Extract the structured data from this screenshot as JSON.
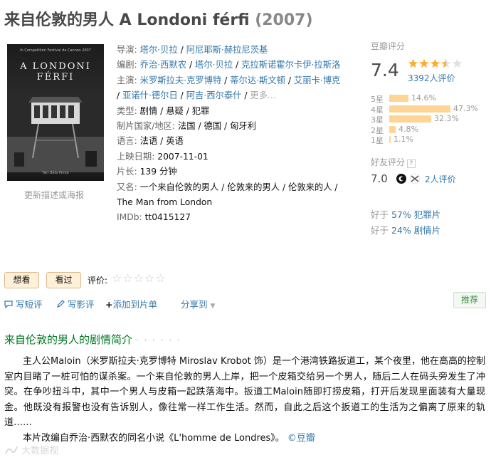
{
  "title": {
    "main": "来自伦敦的男人 A Londoni férfi",
    "year": "(2007)"
  },
  "poster": {
    "title_text": "A LONDONI FÉRFI",
    "festival_text": "In Competition Festival de Cannes 2007",
    "bottom_text": "Tarr Béla filmje",
    "update_link": "更新描述或海报"
  },
  "info": {
    "director": {
      "label": "导演: ",
      "values": [
        "塔尔·贝拉",
        "阿尼耶斯·赫拉尼茨基"
      ]
    },
    "writer": {
      "label": "编剧: ",
      "values": [
        "乔治·西默农",
        "塔尔·贝拉",
        "克拉斯诺霍尔卡伊·拉斯洛"
      ]
    },
    "cast": {
      "label": "主演: ",
      "line1": [
        "米罗斯拉夫·克罗博特",
        "蒂尔达·斯文顿",
        "艾丽卡·博克"
      ],
      "line2": [
        "亚诺什·德尔日",
        "阿吉·西尔泰什"
      ],
      "more": "更多..."
    },
    "genre": {
      "label": "类型: ",
      "value": "剧情 / 悬疑 / 犯罪"
    },
    "country": {
      "label": "制片国家/地区: ",
      "value": "法国 / 德国 / 匈牙利"
    },
    "language": {
      "label": "语言: ",
      "value": "法语 / 英语"
    },
    "release": {
      "label": "上映日期: ",
      "value": "2007-11-01"
    },
    "runtime": {
      "label": "片长: ",
      "value": "139 分钟"
    },
    "aka": {
      "label": "又名: ",
      "value": "一个来自伦敦的男人 / 伦敦来的男人 / 伦敦来的人 /",
      "value2": "The Man from London"
    },
    "imdb": {
      "label": "IMDb: ",
      "value": "tt0415127"
    }
  },
  "rating": {
    "label": "豆瓣评分",
    "score": "7.4",
    "stars": 3.5,
    "votes": "3392人评价",
    "distribution": [
      {
        "label": "5星",
        "percent": 14.6,
        "text": "14.6%"
      },
      {
        "label": "4星",
        "percent": 47.3,
        "text": "47.3%"
      },
      {
        "label": "3星",
        "percent": 32.3,
        "text": "32.3%"
      },
      {
        "label": "2星",
        "percent": 4.8,
        "text": "4.8%"
      },
      {
        "label": "1星",
        "percent": 1.1,
        "text": "1.1%"
      }
    ],
    "friend_label": "好友评分",
    "friend_q": "?",
    "friend_score": "7.0",
    "friend_votes": "2人评价",
    "better_than": [
      {
        "prefix": "好于 ",
        "text": "57% 犯罪片"
      },
      {
        "prefix": "好于 ",
        "text": "24% 剧情片"
      }
    ]
  },
  "interest": {
    "want": "想看",
    "seen": "看过",
    "rate_label": "评价:",
    "rate_stars": "☆☆☆☆☆"
  },
  "actions": {
    "short_review": "写短评",
    "review": "写影评",
    "add_list": "添加到片单",
    "share": "分享到",
    "recommend": "推荐"
  },
  "summary": {
    "title": "来自伦敦的男人的剧情简介",
    "dots": "· · · · · ·",
    "para1": "主人公Maloin（米罗斯拉夫·克罗博特 Miroslav Krobot 饰）是一个港湾铁路扳道工，某个夜里，他在高高的控制室内目睹了一桩可怕的谋杀案。一个来自伦敦的男人上岸，把一个皮箱交给另一个男人，随后二人在码头旁发生了冲突。在争吵扭斗中，其中一个男人与皮箱一起跌落海中。扳道工Maloin随即打捞皮箱，打开后发现里面装有大量现金。他既没有报警也没有告诉别人，像往常一样工作生活。然而，自此之后这个扳道工的生活为之偏离了原来的轨道……",
    "para2": "本片改编自乔治·西默农的同名小说《L'homme de Londres》。",
    "copyright": "©豆瓣"
  },
  "watermark": "大数据视"
}
